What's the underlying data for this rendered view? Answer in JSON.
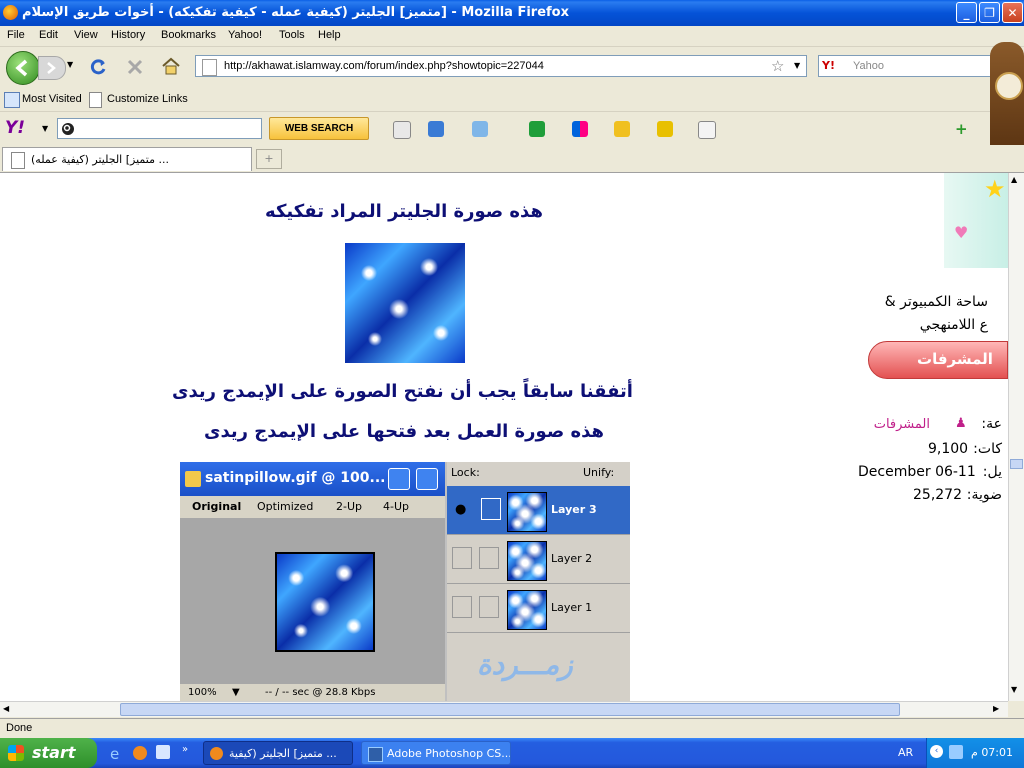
{
  "window": {
    "title": "متميز] الجليتر (كيفية عمله - كيفية تفكيكه) - أخوات طريق الإسلام] - Mozilla Firefox",
    "minimize": "_",
    "maximize": "❐",
    "close": "✕"
  },
  "menu": [
    "File",
    "Edit",
    "View",
    "History",
    "Bookmarks",
    "Yahoo!",
    "Tools",
    "Help"
  ],
  "nav": {
    "url": "http://akhawat.islamway.com/forum/index.php?showtopic=227044",
    "search_placeholder": "Yahoo"
  },
  "bookmarks": [
    "Most Visited",
    "Customize Links"
  ],
  "yahoo_toolbar": {
    "logo": "Y!",
    "search_button": "WEB SEARCH"
  },
  "tab": {
    "label": "متميز] الجليتر (كيفية عمله) ..."
  },
  "content": {
    "heading1": "هذه صورة الجليتر المراد تفكيكه",
    "heading2": "أتفقنا سابقاً يجب أن نفتح الصورة على الإيمدج ريدى",
    "heading3": "هذه صورة العمل بعد فتحها على الإيمدج ريدى",
    "photoshop": {
      "doc_title": "satinpillow.gif @ 100...",
      "tabs": [
        "Original",
        "Optimized",
        "2-Up",
        "4-Up"
      ],
      "zoom": "100%",
      "status": "-- / -- sec @ 28.8 Kbps",
      "lock_label": "Lock:",
      "unify_label": "Unify:",
      "layers": [
        "Layer 3",
        "Layer 2",
        "Layer 1"
      ],
      "watermark": "زمـــردة"
    }
  },
  "sidebar": {
    "line1": "ساحة الكمبيوتر &",
    "line2": "ع اللامنهجي",
    "badge": "المشرفات",
    "group_label": "عة:",
    "group_value": "المشرفات",
    "posts_label": "كات:",
    "posts_value": "9,100",
    "joined_label": "يل:",
    "joined_value": "06-11 December",
    "member_label": "ضوية:",
    "member_value": "25,272"
  },
  "status": "Done",
  "taskbar": {
    "start": "start",
    "tasks": [
      "متميز] الجليتر (كيفية ...",
      "Adobe Photoshop CS..."
    ],
    "lang": "AR",
    "clock": "07:01 م"
  },
  "colors": {
    "heading": "#0d0f75",
    "accent_blue": "#0553d8",
    "magenta_link": "#c0208a"
  }
}
